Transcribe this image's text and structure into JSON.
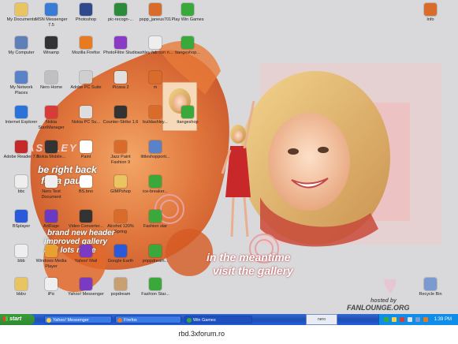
{
  "desktop": {
    "wallpaper_texts": {
      "name": "ASHLEY",
      "be_right_back": "be right back",
      "for_a_pause": "for a pause",
      "brand_new_header": "brand new header",
      "improved_gallery": "improved gallery",
      "and_lots_more": "and lots more",
      "in_the_meantime": "in the meantime",
      "visit_the_gallery": "visit the gallery",
      "hosted_by": "hosted by",
      "fanlounge": "FANLOUNGE.ORG"
    },
    "icons": [
      {
        "label": "My Documents",
        "color": "#e8c560"
      },
      {
        "label": "MSN Messenger 7.5",
        "color": "#3a7bd5"
      },
      {
        "label": "Photoshop",
        "color": "#2f4a8c"
      },
      {
        "label": "pic-recogn-...",
        "color": "#2a8c3a"
      },
      {
        "label": "pspp_janeus701",
        "color": "#d96b2b"
      },
      {
        "label": "Play Win Games",
        "color": "#3aa83a"
      },
      {
        "label": "My Computer",
        "color": "#5f7fb8"
      },
      {
        "label": "Winamp",
        "color": "#333333"
      },
      {
        "label": "Mozilla Firefox",
        "color": "#e87a1f"
      },
      {
        "label": "PhotoFiltre Studio",
        "color": "#8a3ac4"
      },
      {
        "label": "ashley fab con n...",
        "color": "#eeeeee"
      },
      {
        "label": "ttangeshop...",
        "color": "#3aa83a"
      },
      {
        "label": "My Network Places",
        "color": "#5a82c8"
      },
      {
        "label": "Nero Home",
        "color": "#c0c0c0"
      },
      {
        "label": "Adobe PC Suite",
        "color": "#cfcfcf"
      },
      {
        "label": "Picasa 2",
        "color": "#e0e0e0"
      },
      {
        "label": "m",
        "color": "#d96b2b"
      },
      {
        "label": "Internet Explorer",
        "color": "#2a73d9"
      },
      {
        "label": "Nokia StartManager",
        "color": "#d93a3a"
      },
      {
        "label": "Nokia PC Su...",
        "color": "#dddddd"
      },
      {
        "label": "Counter-Strike 1.6",
        "color": "#333333"
      },
      {
        "label": "buildashley...",
        "color": "#d96b2b"
      },
      {
        "label": "ttangeshop",
        "color": "#3aa83a"
      },
      {
        "label": "Adobe Reader 7.0",
        "color": "#c42a2a"
      },
      {
        "label": "Nokia Mobile...",
        "color": "#333333"
      },
      {
        "label": "Paint",
        "color": "#ffffff"
      },
      {
        "label": "Jazz Paint Fashion 9",
        "color": "#d96b2b"
      },
      {
        "label": "littleshopporti...",
        "color": "#5a82c8"
      },
      {
        "label": "bbc",
        "color": "#eeeeee"
      },
      {
        "label": "Nero Text Document",
        "color": "#eeeeee"
      },
      {
        "label": "BS.bno",
        "color": "#ffffff"
      },
      {
        "label": "GIMPshop",
        "color": "#e8c560"
      },
      {
        "label": "ice-breaker...",
        "color": "#3aa83a"
      },
      {
        "label": "BSplayer",
        "color": "#2a5ad9"
      },
      {
        "label": "ArtRage",
        "color": "#6a3ac4"
      },
      {
        "label": "Video Converter...",
        "color": "#333333"
      },
      {
        "label": "Alcohol 120% Spring",
        "color": "#d96b2b"
      },
      {
        "label": "Fashion star",
        "color": "#3aa83a"
      },
      {
        "label": "bbb",
        "color": "#eeeeee"
      },
      {
        "label": "Windows Media Player",
        "color": "#e8a030"
      },
      {
        "label": "Yahoo! Mail",
        "color": "#7a3ac4"
      },
      {
        "label": "Google Earth",
        "color": "#2a5ad9"
      },
      {
        "label": "poppdream...",
        "color": "#3aa83a"
      },
      {
        "label": "bbbv",
        "color": "#e8c560"
      },
      {
        "label": "iPic",
        "color": "#eeeeee"
      },
      {
        "label": "Yahoo! Messenger",
        "color": "#7a3ac4"
      },
      {
        "label": "popdream",
        "color": "#c8a070"
      },
      {
        "label": "Fashion Star...",
        "color": "#3aa83a"
      },
      {
        "label": "Info",
        "color": "#d96b2b"
      },
      {
        "label": "Recycle Bin",
        "color": "#7a9ad0"
      }
    ]
  },
  "taskbar": {
    "start_label": "start",
    "buttons": [
      {
        "label": "Yahoo! Messenger",
        "color": "#ffd23a"
      },
      {
        "label": "Firefox",
        "color": "#e87a1f"
      },
      {
        "label": "Win Games",
        "color": "#3aa83a"
      }
    ],
    "nero_label": "nero",
    "clock": "1:39 PM"
  },
  "footer": {
    "site": "rbd.3xforum.ro"
  }
}
